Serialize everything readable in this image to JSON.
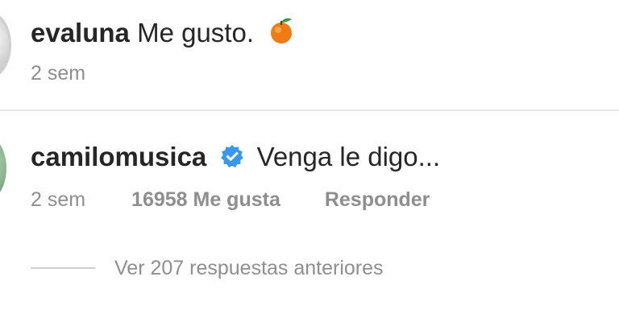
{
  "comments": [
    {
      "username": "evaluna",
      "text": "Me gusto.",
      "emoji": "orange-tangerine-emoji",
      "time": "2 sem"
    },
    {
      "username": "camilomusica",
      "verified": true,
      "text": "Venga le digo...",
      "time": "2 sem",
      "likes": "16958 Me gusta",
      "reply_label": "Responder",
      "view_replies": "Ver 207 respuestas anteriores"
    }
  ],
  "colors": {
    "text": "#262626",
    "meta": "#8e8e8e",
    "verified": "#3897f0",
    "divider": "#e6e6e6"
  }
}
